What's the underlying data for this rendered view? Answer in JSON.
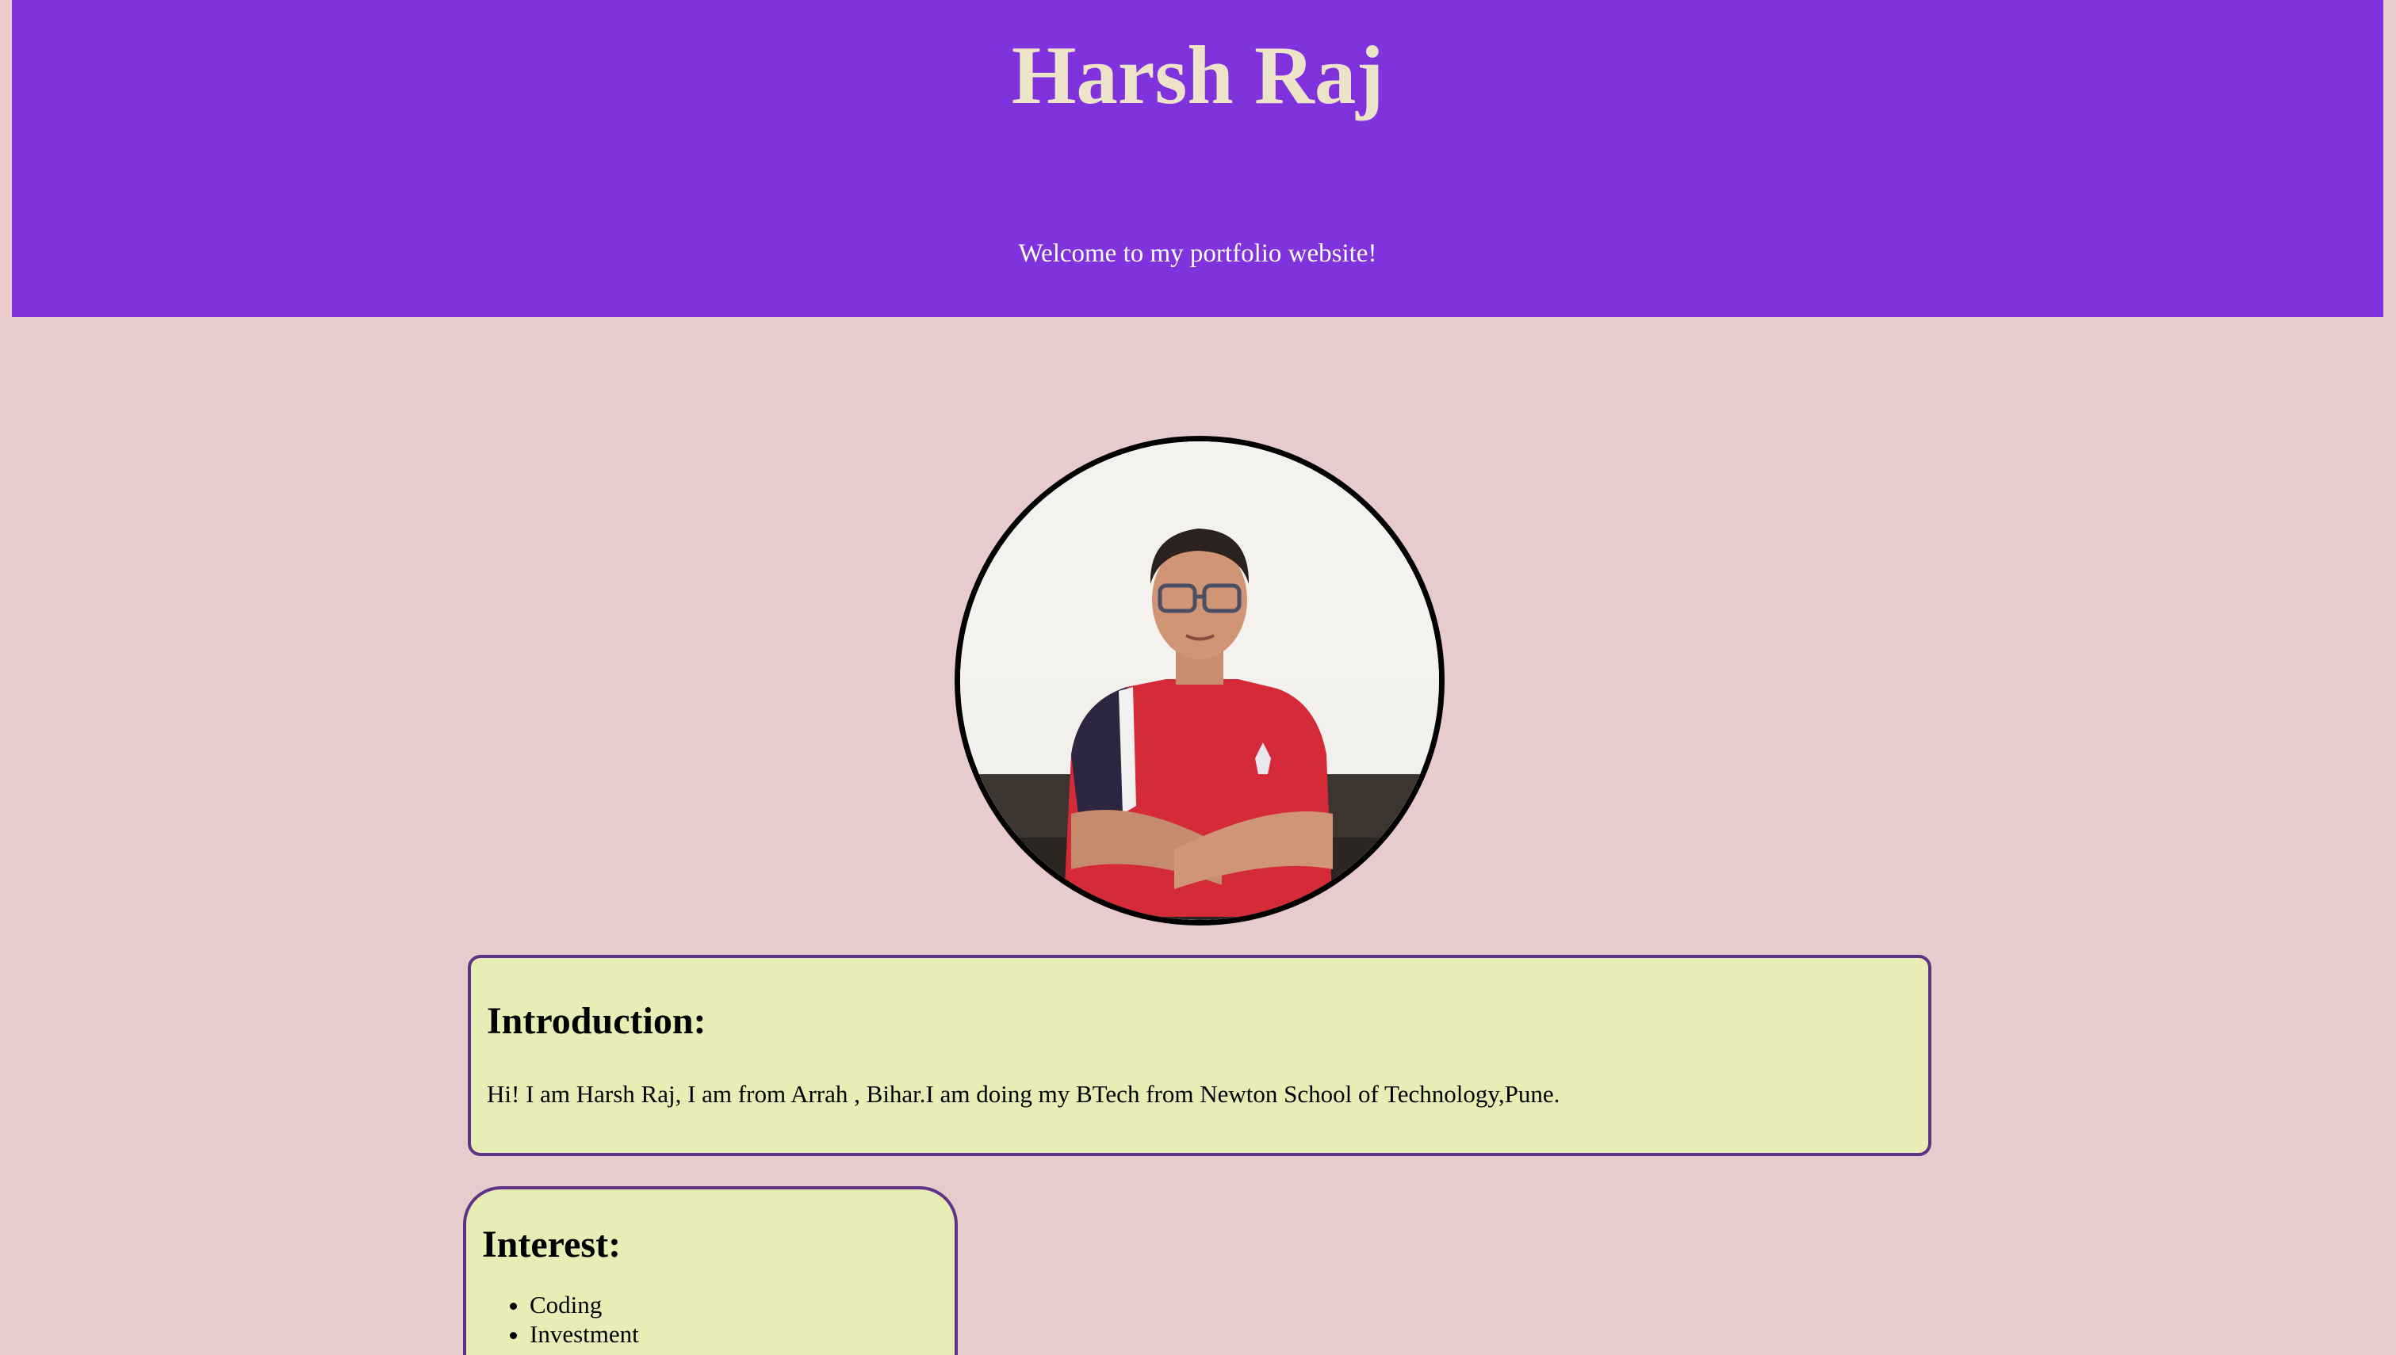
{
  "header": {
    "title": "Harsh Raj",
    "tagline": "Welcome to my portfolio website!"
  },
  "profile": {
    "photo_alt": "profile photo"
  },
  "introduction": {
    "heading": "Introduction:",
    "text": "Hi! I am Harsh Raj, I am from Arrah , Bihar.I am doing my BTech from Newton School of Technology,Pune."
  },
  "interest": {
    "heading": "Interest:",
    "items": [
      "Coding",
      "Investment"
    ]
  },
  "colors": {
    "background": "#e8cbcc",
    "header": "#8032dc",
    "title": "#ece3c8",
    "card": "#e8edb5",
    "card_border": "#5e3386"
  }
}
